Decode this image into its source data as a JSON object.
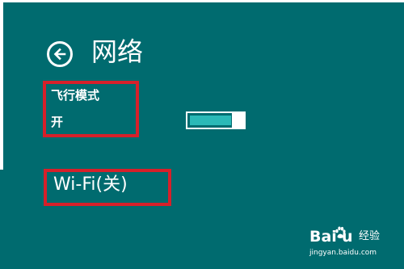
{
  "header": {
    "title": "网络"
  },
  "airplane_mode": {
    "label": "飞行模式",
    "state": "开",
    "on": true
  },
  "wifi": {
    "label": "Wi-Fi(关)"
  },
  "watermark": {
    "brand_left": "Bai",
    "brand_right": "u",
    "product": "经验",
    "url": "jingyan.baidu.com"
  },
  "colors": {
    "background": "#006b6f",
    "highlight_box": "#d6202a",
    "toggle_fill": "#2bb9b7",
    "text": "#ffffff"
  },
  "icons": {
    "back": "back-arrow-circle-icon",
    "watermark": "baidu-paw-icon"
  }
}
